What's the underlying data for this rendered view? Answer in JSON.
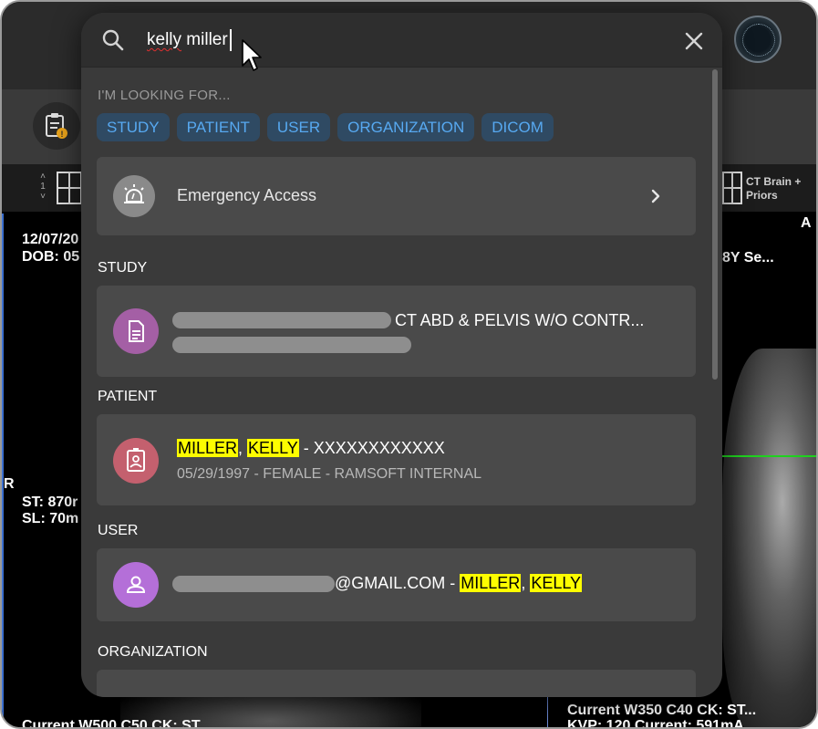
{
  "search": {
    "query_part1": "kelly",
    "query_part2": " miller"
  },
  "looking_for": {
    "label": "I'M LOOKING FOR...",
    "chips": [
      "STUDY",
      "PATIENT",
      "USER",
      "ORGANIZATION",
      "DICOM"
    ]
  },
  "emergency": {
    "label": "Emergency Access"
  },
  "sections": {
    "study": "STUDY",
    "patient": "PATIENT",
    "user": "USER",
    "organization": "ORGANIZATION"
  },
  "study_result": {
    "title": "CT ABD & PELVIS W/O CONTR..."
  },
  "patient_result": {
    "last": "MILLER",
    "first": "KELLY",
    "sep": ", ",
    "suffix": " - XXXXXXXXXXXX",
    "details": "05/29/1997 - FEMALE - RAMSOFT INTERNAL"
  },
  "user_result": {
    "email_suffix": "@GMAIL.COM - ",
    "last": "MILLER",
    "sep": ", ",
    "first": "KELLY"
  },
  "background": {
    "toolbar_spinner_value": "1",
    "right_layout_label_line1": "CT Brain +",
    "right_layout_label_line2": "Priors",
    "left_overlay_date": "12/07/20",
    "left_overlay_dob": "DOB: 05",
    "left_orientation": "R",
    "left_st": "ST: 870r",
    "left_sl": "SL: 70m",
    "left_bottom": "Current  W500 C50  CK: ST",
    "right_orientation": "A",
    "right_age": "8Y  Se...",
    "right_bottom_1": "Current  W350 C40  CK: ST...",
    "right_bottom_2": "KVP: 120  Current: 591mA"
  },
  "colors": {
    "chip_bg": "#2f4a63",
    "chip_text": "#57a9f1",
    "highlight": "#fdfd00",
    "study_avatar": "#a45fa5",
    "patient_avatar": "#c4606e",
    "user_avatar": "#b46fd8"
  },
  "icons": {
    "search": "search-icon",
    "close": "close-icon",
    "emergency": "siren-icon",
    "study": "document-icon",
    "patient": "id-badge-icon",
    "user": "person-icon"
  }
}
